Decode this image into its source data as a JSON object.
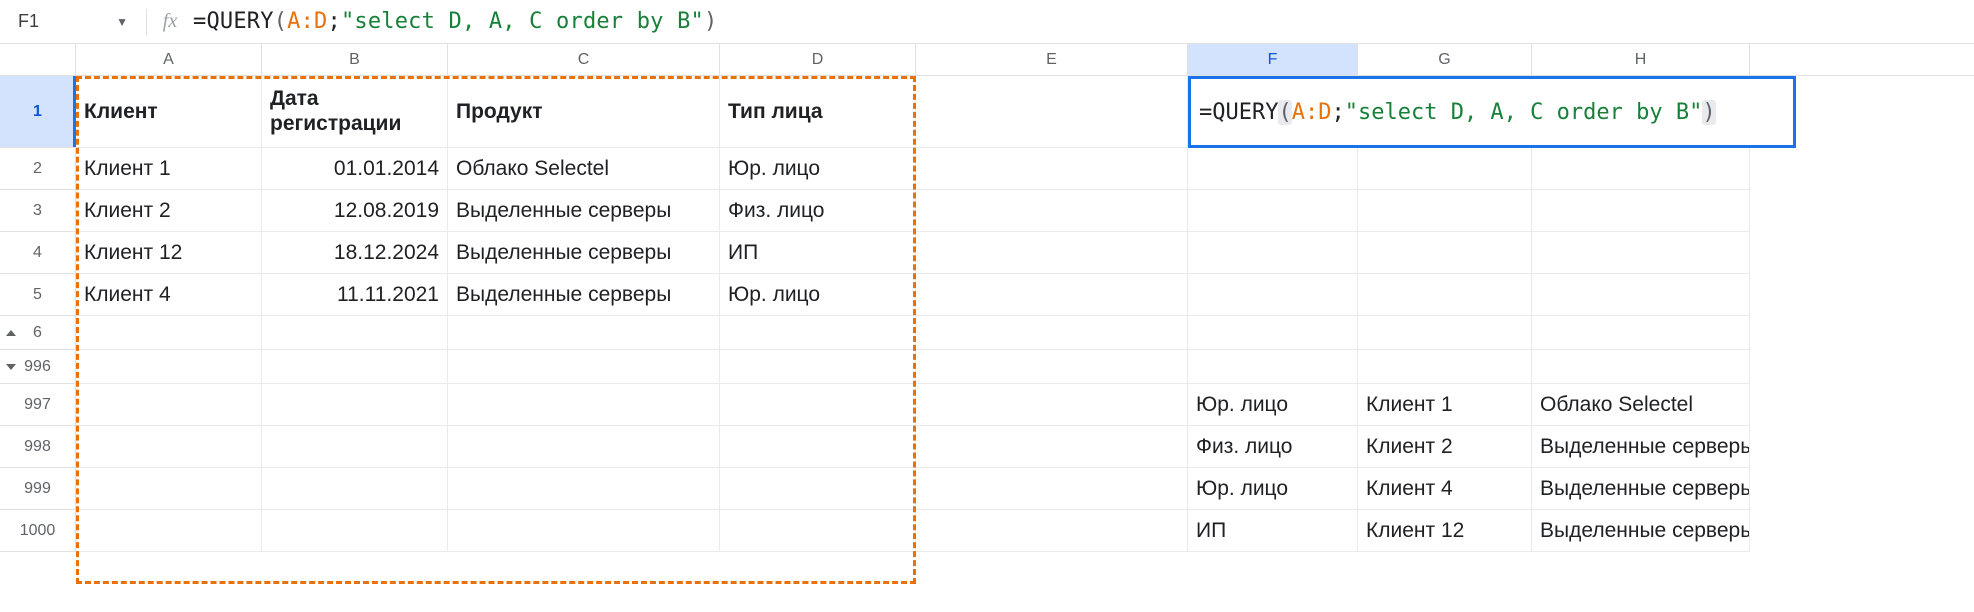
{
  "formula_bar": {
    "name_box": "F1",
    "formula_tokens": {
      "eq": "=",
      "func": "QUERY",
      "open": "(",
      "range": "A:D",
      "sep": ";",
      "str": "\"select D, A, C order by B\"",
      "close": ")"
    }
  },
  "columns": [
    "A",
    "B",
    "C",
    "D",
    "E",
    "F",
    "G",
    "H"
  ],
  "selected_column": "F",
  "row_labels": {
    "r1": "1",
    "r2": "2",
    "r3": "3",
    "r4": "4",
    "r5": "5",
    "r6": "6",
    "r996": "996",
    "r997": "997",
    "r998": "998",
    "r999": "999",
    "r1000": "1000"
  },
  "headers": {
    "A": "Клиент",
    "B": "Дата регистрации",
    "C": "Продукт",
    "D": "Тип лица"
  },
  "data_rows": [
    {
      "A": "Клиент 1",
      "B": "01.01.2014",
      "C": "Облако Selectel",
      "D": "Юр. лицо"
    },
    {
      "A": "Клиент 2",
      "B": "12.08.2019",
      "C": "Выделенные серверы",
      "D": "Физ. лицо"
    },
    {
      "A": "Клиент 12",
      "B": "18.12.2024",
      "C": "Выделенные серверы",
      "D": "ИП"
    },
    {
      "A": "Клиент 4",
      "B": "11.11.2021",
      "C": "Выделенные серверы",
      "D": "Юр. лицо"
    }
  ],
  "result_rows": [
    {
      "F": "Юр. лицо",
      "G": "Клиент 1",
      "H": "Облако Selectel"
    },
    {
      "F": "Физ. лицо",
      "G": "Клиент 2",
      "H": "Выделенные серверы"
    },
    {
      "F": "Юр. лицо",
      "G": "Клиент 4",
      "H": "Выделенные серверы"
    },
    {
      "F": "ИП",
      "G": "Клиент 12",
      "H": "Выделенные серверы"
    }
  ],
  "active_cell_formula": {
    "eq": "=",
    "func": "QUERY",
    "open": "(",
    "range": "A:D",
    "sep": ";",
    "str": "\"select D, A, C order by B\"",
    "close": ")"
  }
}
